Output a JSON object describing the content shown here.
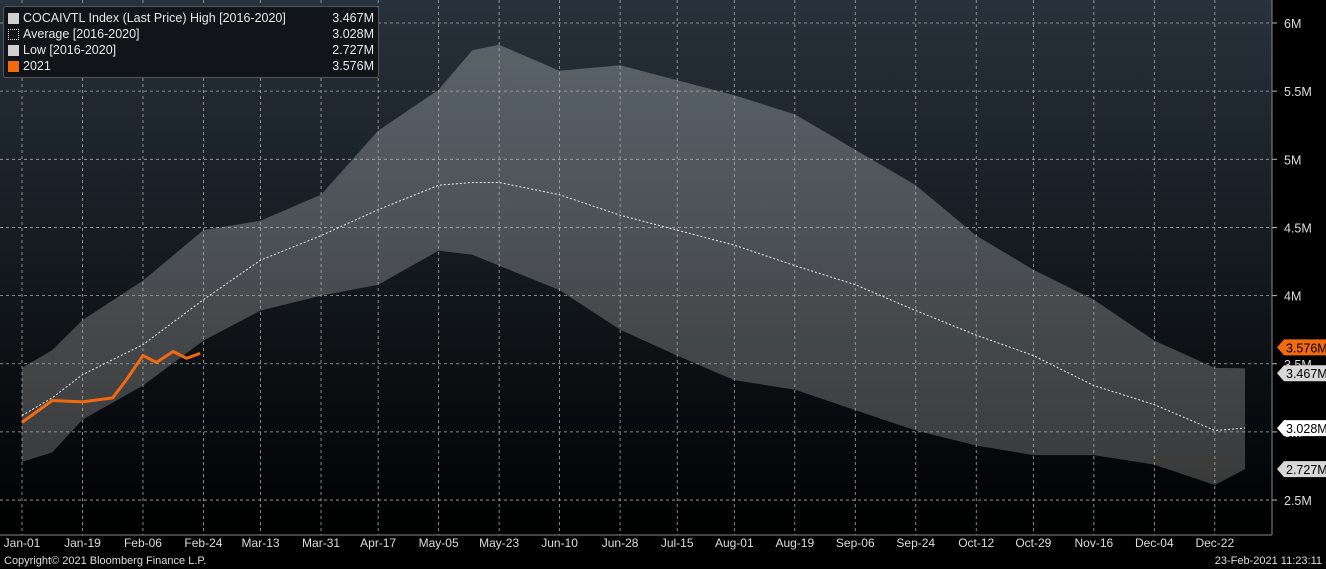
{
  "legend": [
    {
      "label": "COCAIVTL Index (Last Price) High [2016-2020]",
      "value": "3.467M",
      "color": "#d0d0d0"
    },
    {
      "label": "Average  [2016-2020]",
      "value": "3.028M",
      "color": "dotted"
    },
    {
      "label": "Low  [2016-2020]",
      "value": "2.727M",
      "color": "#d0d0d0"
    },
    {
      "label": "2021",
      "value": "3.576M",
      "color": "#f26a0f"
    }
  ],
  "footer": "Copyright© 2021 Bloomberg Finance L.P.",
  "timestamp": "23-Feb-2021 11:23:11",
  "chart_data": {
    "type": "area",
    "title": "COCAIVTL Index (Last Price)",
    "yunit": "M",
    "ylim": [
      2.35,
      6.15
    ],
    "yticks": [
      2.5,
      3,
      3.5,
      4,
      4.5,
      5,
      5.5,
      6
    ],
    "ytick_labels": [
      "2.5M",
      "3M",
      "3.5M",
      "4M",
      "4.5M",
      "5M",
      "5.5M",
      "6M"
    ],
    "xlim_day": [
      -6,
      372
    ],
    "xticks": [
      {
        "day": 0,
        "label": "Jan-01"
      },
      {
        "day": 18,
        "label": "Jan-19"
      },
      {
        "day": 36,
        "label": "Feb-06"
      },
      {
        "day": 54,
        "label": "Feb-24"
      },
      {
        "day": 71,
        "label": "Mar-13"
      },
      {
        "day": 89,
        "label": "Mar-31"
      },
      {
        "day": 106,
        "label": "Apr-17"
      },
      {
        "day": 124,
        "label": "May-05"
      },
      {
        "day": 142,
        "label": "May-23"
      },
      {
        "day": 160,
        "label": "Jun-10"
      },
      {
        "day": 178,
        "label": "Jun-28"
      },
      {
        "day": 195,
        "label": "Jul-15"
      },
      {
        "day": 212,
        "label": "Aug-01"
      },
      {
        "day": 230,
        "label": "Aug-19"
      },
      {
        "day": 248,
        "label": "Sep-06"
      },
      {
        "day": 266,
        "label": "Sep-24"
      },
      {
        "day": 284,
        "label": "Oct-12"
      },
      {
        "day": 301,
        "label": "Oct-29"
      },
      {
        "day": 319,
        "label": "Nov-16"
      },
      {
        "day": 337,
        "label": "Dec-04"
      },
      {
        "day": 355,
        "label": "Dec-22"
      }
    ],
    "band_days": [
      0,
      9,
      18,
      36,
      54,
      71,
      89,
      106,
      124,
      134,
      142,
      160,
      178,
      195,
      212,
      230,
      248,
      266,
      284,
      301,
      319,
      337,
      355,
      364
    ],
    "high": [
      3.47,
      3.6,
      3.82,
      4.11,
      4.48,
      4.55,
      4.74,
      5.21,
      5.51,
      5.8,
      5.84,
      5.65,
      5.69,
      5.58,
      5.47,
      5.33,
      5.07,
      4.81,
      4.44,
      4.19,
      3.97,
      3.67,
      3.47,
      3.467
    ],
    "low": [
      2.78,
      2.85,
      3.09,
      3.34,
      3.67,
      3.89,
      4.0,
      4.08,
      4.33,
      4.3,
      4.22,
      4.04,
      3.75,
      3.56,
      3.38,
      3.31,
      3.16,
      3.01,
      2.9,
      2.83,
      2.83,
      2.76,
      2.61,
      2.727
    ],
    "average": [
      3.12,
      3.25,
      3.42,
      3.64,
      3.97,
      4.26,
      4.44,
      4.63,
      4.81,
      4.83,
      4.83,
      4.74,
      4.59,
      4.48,
      4.37,
      4.22,
      4.08,
      3.89,
      3.71,
      3.56,
      3.34,
      3.2,
      3.01,
      3.028
    ],
    "series_2021": {
      "days": [
        0,
        9,
        18,
        27,
        31,
        36,
        40,
        45,
        49,
        53
      ],
      "values": [
        3.07,
        3.23,
        3.22,
        3.25,
        3.38,
        3.56,
        3.51,
        3.59,
        3.54,
        3.576
      ]
    },
    "last_value_tags": [
      {
        "label": "3.576M",
        "value": 3.576,
        "color": "#f26a0f"
      },
      {
        "label": "3.467M",
        "value": 3.467,
        "color": "#d8d8d8"
      },
      {
        "label": "3.028M",
        "value": 3.028,
        "color": "#ffffff"
      },
      {
        "label": "2.727M",
        "value": 2.727,
        "color": "#d8d8d8"
      }
    ]
  }
}
